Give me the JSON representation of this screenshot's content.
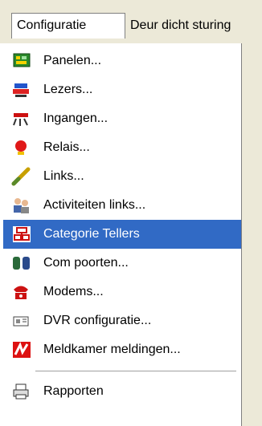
{
  "menubar": {
    "items": [
      {
        "label": "Configuratie"
      },
      {
        "label": "Deur dicht sturing"
      }
    ]
  },
  "menu": {
    "items": [
      {
        "label": "Panelen...",
        "icon": "panel-icon"
      },
      {
        "label": "Lezers...",
        "icon": "reader-icon"
      },
      {
        "label": "Ingangen...",
        "icon": "input-icon"
      },
      {
        "label": "Relais...",
        "icon": "relay-icon"
      },
      {
        "label": "Links...",
        "icon": "link-icon"
      },
      {
        "label": "Activiteiten links...",
        "icon": "activity-links-icon"
      },
      {
        "label": "Categorie Tellers",
        "icon": "category-counters-icon",
        "highlighted": true
      },
      {
        "label": "Com poorten...",
        "icon": "com-ports-icon"
      },
      {
        "label": "Modems...",
        "icon": "modem-icon"
      },
      {
        "label": "DVR configuratie...",
        "icon": "dvr-icon"
      },
      {
        "label": "Meldkamer meldingen...",
        "icon": "alarm-center-icon"
      },
      {
        "label": "Rapporten",
        "icon": "printer-icon"
      }
    ]
  },
  "colors": {
    "highlight": "#316ac5",
    "menu_background": "#ffffff",
    "menubar_background": "#ece9d8"
  }
}
